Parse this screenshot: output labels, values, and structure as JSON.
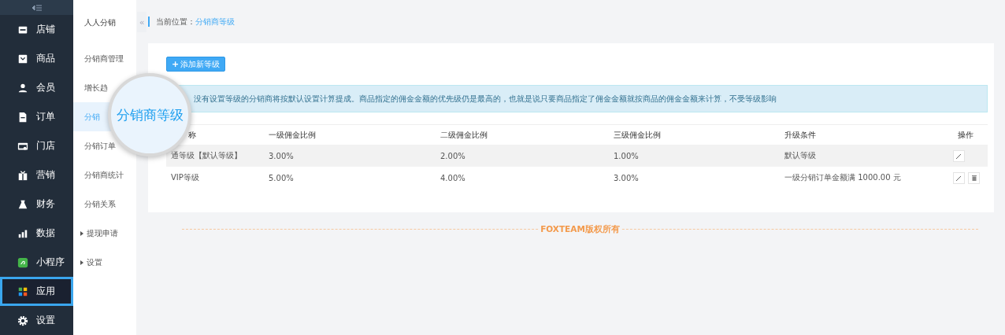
{
  "sidebar": {
    "items": [
      {
        "label": "店铺",
        "selected": false,
        "highlighted": false
      },
      {
        "label": "商品",
        "selected": false,
        "highlighted": false
      },
      {
        "label": "会员",
        "selected": false,
        "highlighted": false
      },
      {
        "label": "订单",
        "selected": false,
        "highlighted": false
      },
      {
        "label": "门店",
        "selected": false,
        "highlighted": false
      },
      {
        "label": "营销",
        "selected": false,
        "highlighted": false
      },
      {
        "label": "财务",
        "selected": false,
        "highlighted": false
      },
      {
        "label": "数据",
        "selected": false,
        "highlighted": false
      },
      {
        "label": "小程序",
        "selected": false,
        "highlighted": false
      },
      {
        "label": "应用",
        "selected": true,
        "highlighted": true
      },
      {
        "label": "设置",
        "selected": false,
        "highlighted": false
      }
    ]
  },
  "subnav": {
    "title": "人人分销",
    "collapse": "«",
    "items": [
      {
        "label": "分销商管理",
        "kind": "link",
        "selected": false
      },
      {
        "label": "增长趋",
        "kind": "link",
        "selected": false
      },
      {
        "label": "分销",
        "kind": "link",
        "selected": true
      },
      {
        "label": "分销订单",
        "kind": "link",
        "selected": false
      },
      {
        "label": "分销商统计",
        "kind": "link",
        "selected": false
      },
      {
        "label": "分销关系",
        "kind": "link",
        "selected": false
      },
      {
        "label": "提现申请",
        "kind": "group",
        "selected": false
      },
      {
        "label": "设置",
        "kind": "group",
        "selected": false
      }
    ]
  },
  "breadcrumb": {
    "label": "当前位置：",
    "current": "分销商等级"
  },
  "add_button": {
    "icon": "+",
    "label": "添加新等级"
  },
  "notice": "没有设置等级的分销商将按默认设置计算提成。商品指定的佣金金额的优先级仍是最高的，也就是说只要商品指定了佣金金额就按商品的佣金金额来计算，不受等级影响",
  "table": {
    "columns": [
      "称",
      "一级佣金比例",
      "二级佣金比例",
      "三级佣金比例",
      "升级条件",
      "操作"
    ],
    "rows": [
      {
        "cells": [
          "通等级【默认等级】",
          "3.00%",
          "2.00%",
          "1.00%",
          "默认等级"
        ],
        "deletable": false
      },
      {
        "cells": [
          "VIP等级",
          "5.00%",
          "4.00%",
          "3.00%",
          "一级分销订单金额满 1000.00 元"
        ],
        "deletable": true
      }
    ]
  },
  "footer": "FOXTEAM版权所有",
  "magnifier": {
    "text": "分销商等级"
  }
}
